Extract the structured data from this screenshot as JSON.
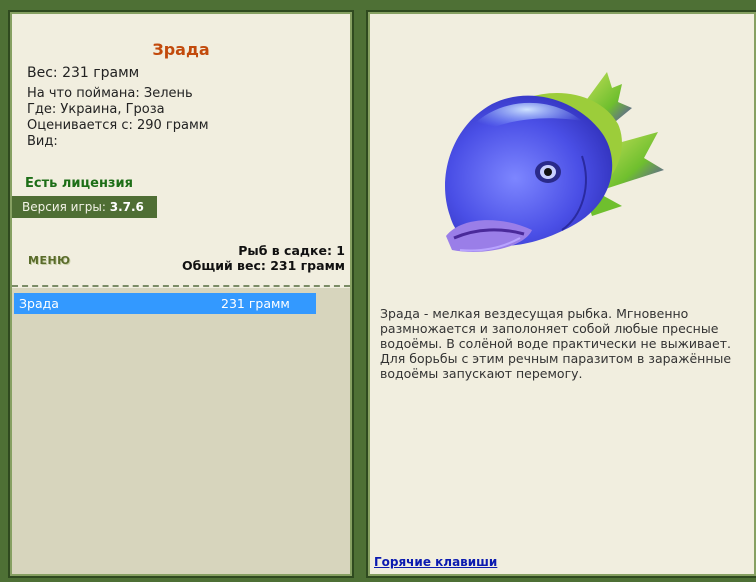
{
  "fish": {
    "name": "Зрада",
    "weight": "Вес: 231 грамм",
    "bait": "На что поймана: Зелень",
    "location": "Где: Украина, Гроза",
    "value": "Оценивается с: 290 грамм",
    "kind": "Вид:"
  },
  "license": "Есть лицензия",
  "version": {
    "label": "Версия игры:",
    "number": "3.7.6"
  },
  "menu_label": "МЕНЮ",
  "keepnet": {
    "count": "Рыб в садке: 1",
    "total": "Общий вес: 231 грамм"
  },
  "catch_list": [
    {
      "name": "Зрада",
      "weight": "231 грамм"
    }
  ],
  "description": "Зрада - мелкая вездесущая рыбка. Мгновенно размножается и заполоняет собой любые пресные водоёмы. В солёной воде практически не выживает. Для борьбы с этим речным паразитом в заражённые водоёмы запускают перемогу.",
  "hotkeys_link": "Горячие клавиши",
  "colors": {
    "background": "#4e7035",
    "panel": "#f1eedf",
    "fish_name": "#c24a0c",
    "license": "#1d6e17",
    "selection": "#3399ff"
  },
  "icons": {
    "fish_image": "blue-fish-with-green-fins"
  }
}
